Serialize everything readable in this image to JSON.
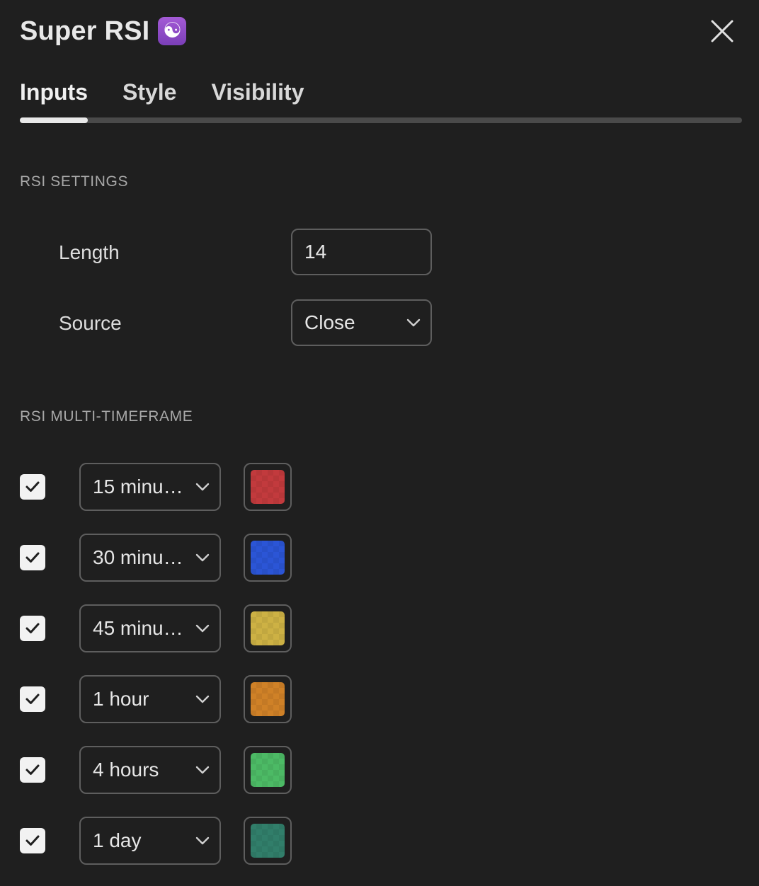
{
  "header": {
    "title": "Super RSI",
    "emoji": "☯",
    "emoji_icon": "yin-yang-icon",
    "close_icon": "close-icon"
  },
  "tabs": [
    {
      "label": "Inputs",
      "active": true
    },
    {
      "label": "Style",
      "active": false
    },
    {
      "label": "Visibility",
      "active": false
    }
  ],
  "rsi_settings": {
    "heading": "RSI SETTINGS",
    "length": {
      "label": "Length",
      "value": "14"
    },
    "source": {
      "label": "Source",
      "value": "Close"
    }
  },
  "multi_timeframe": {
    "heading": "RSI MULTI-TIMEFRAME",
    "rows": [
      {
        "checked": true,
        "timeframe": "15 minu…",
        "color": "#c23a3d"
      },
      {
        "checked": true,
        "timeframe": "30 minu…",
        "color": "#2b55d6"
      },
      {
        "checked": true,
        "timeframe": "45 minu…",
        "color": "#cdb144"
      },
      {
        "checked": true,
        "timeframe": "1 hour",
        "color": "#cf8127"
      },
      {
        "checked": true,
        "timeframe": "4 hours",
        "color": "#4cba65"
      },
      {
        "checked": true,
        "timeframe": "1 day",
        "color": "#317e6a"
      }
    ]
  }
}
